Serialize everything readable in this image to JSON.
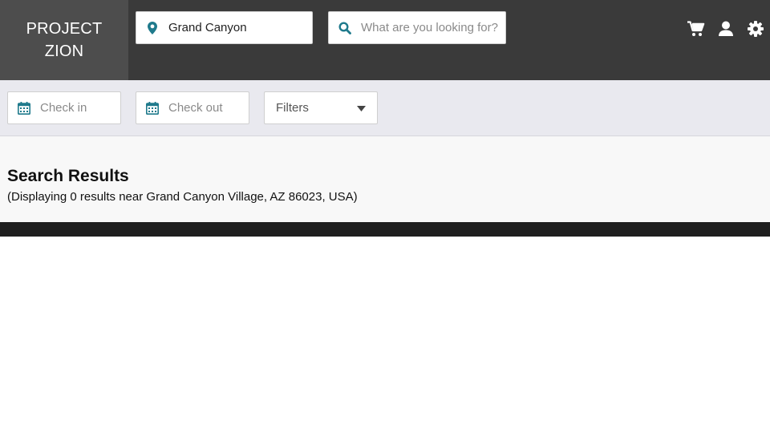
{
  "brand": {
    "line1": "PROJECT",
    "line2": "ZION"
  },
  "header": {
    "location": {
      "value": "Grand Canyon",
      "icon": "map-marker-icon"
    },
    "search": {
      "placeholder": "What are you looking for?",
      "icon": "search-icon"
    },
    "icons": [
      "cart-icon",
      "user-icon",
      "gear-icon"
    ]
  },
  "filters": {
    "checkin_placeholder": "Check in",
    "checkout_placeholder": "Check out",
    "filters_label": "Filters"
  },
  "results": {
    "title": "Search Results",
    "subtitle": "(Displaying 0 results near Grand Canyon Village, AZ 86023, USA)"
  },
  "colors": {
    "topbar": "#3a3a3a",
    "logo_bg": "#4d4d4d",
    "accent": "#1f7a8c",
    "filterbar": "#e9e9ef",
    "results_bg": "#f8f8f8",
    "strip": "#1f1f1f"
  }
}
